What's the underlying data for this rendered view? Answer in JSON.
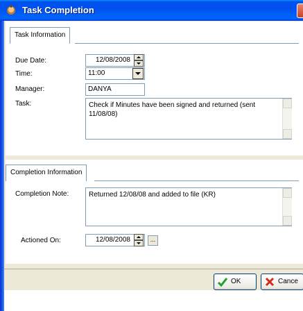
{
  "window": {
    "title": "Task Completion"
  },
  "task_info": {
    "tab_label": "Task Information",
    "due_date_label": "Due Date:",
    "due_date_value": "12/08/2008",
    "time_label": "Time:",
    "time_value": "11:00",
    "manager_label": "Manager:",
    "manager_value": "DANYA",
    "task_label": "Task:",
    "task_value": "Check if Minutes have been signed and returned (sent 11/08/08)"
  },
  "completion_info": {
    "tab_label": "Completion Information",
    "note_label": "Completion Note:",
    "note_value": "Returned 12/08/08 and added to file (KR)",
    "actioned_label": "Actioned On:",
    "actioned_value": "12/08/2008",
    "ellipsis_label": "..."
  },
  "buttons": {
    "ok_label": "OK",
    "cancel_label": "Cance"
  },
  "icons": {
    "title": "task-app-icon",
    "spin": "spin-updown-icon",
    "dropdown": "chevron-down-icon",
    "ok": "check-icon",
    "cancel": "x-icon"
  }
}
